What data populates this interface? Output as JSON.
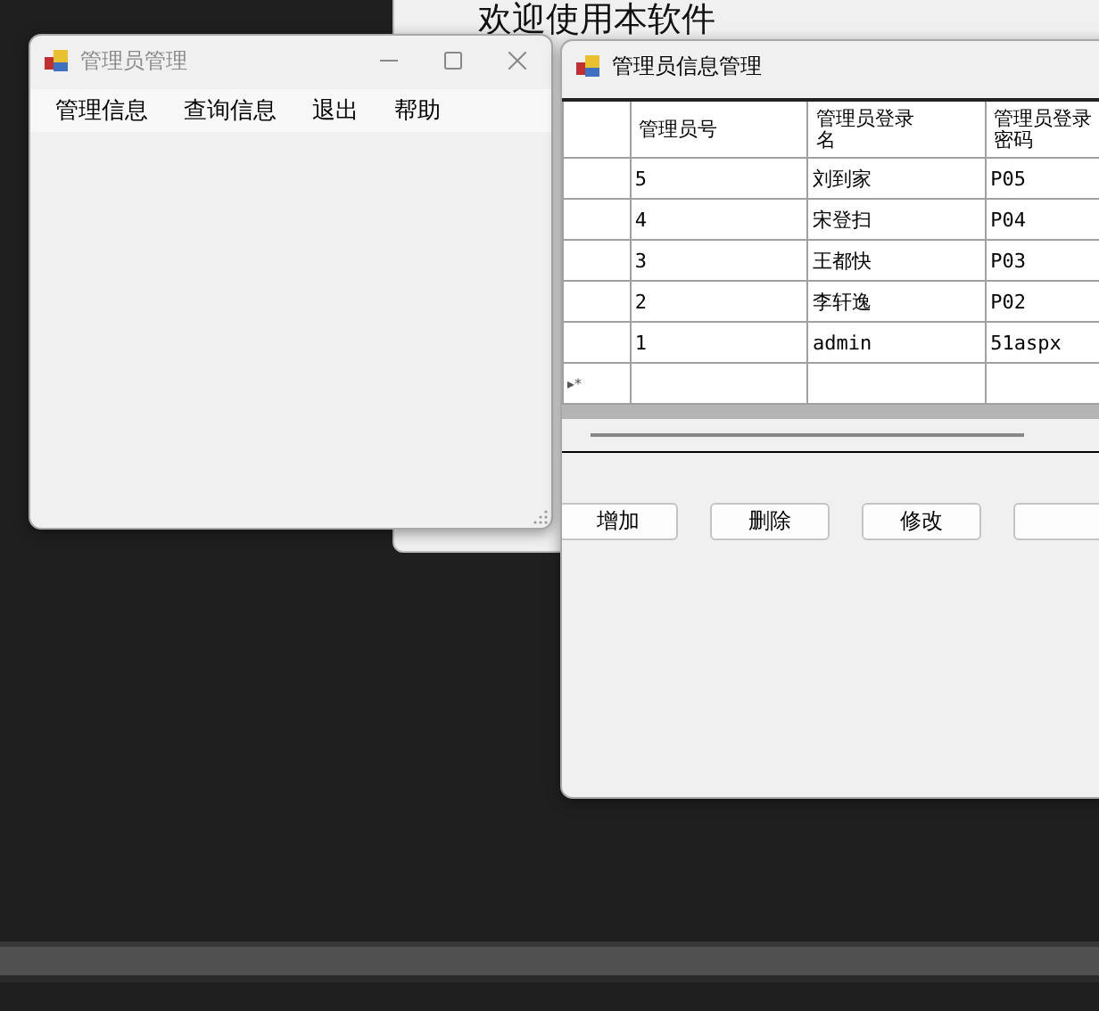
{
  "background_window": {
    "heading": "欢迎使用本软件"
  },
  "admin_window": {
    "title": "管理员管理",
    "menu": [
      {
        "label": "管理信息"
      },
      {
        "label": "查询信息"
      },
      {
        "label": "退出"
      },
      {
        "label": "帮助"
      }
    ]
  },
  "info_window": {
    "title": "管理员信息管理",
    "table": {
      "columns": [
        "管理员号",
        "管理员登录名",
        "管理员登录密码"
      ],
      "rows": [
        [
          "5",
          "刘到家",
          "P05"
        ],
        [
          "4",
          "宋登扫",
          "P04"
        ],
        [
          "3",
          "王都快",
          "P03"
        ],
        [
          "2",
          "李轩逸",
          "P02"
        ],
        [
          "1",
          "admin",
          "51aspx"
        ]
      ],
      "new_row_marker": "▸*"
    },
    "buttons": [
      {
        "label": "增加"
      },
      {
        "label": "删除"
      },
      {
        "label": "修改"
      }
    ]
  }
}
